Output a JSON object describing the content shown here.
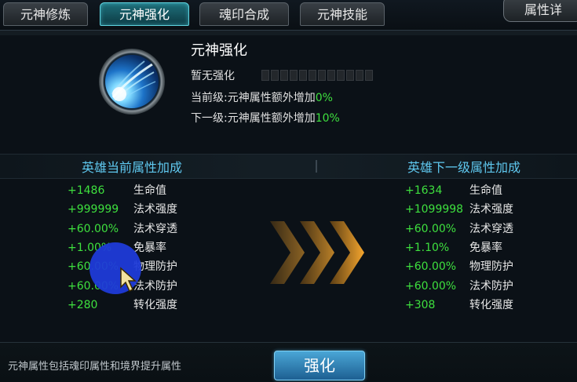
{
  "tabs": [
    {
      "label": "元神修炼",
      "active": false
    },
    {
      "label": "元神强化",
      "active": true
    },
    {
      "label": "魂印合成",
      "active": false
    },
    {
      "label": "元神技能",
      "active": false
    }
  ],
  "side_button": {
    "label": "属性详"
  },
  "header": {
    "title": "元神强化",
    "level_status": "暂无强化",
    "level_progress_segments_filled": 0,
    "current_level_label": "当前级:元神属性额外增加",
    "current_level_value": "0%",
    "next_level_label": "下一级:元神属性额外增加",
    "next_level_value": "10%",
    "icon": "spirit-comet-icon"
  },
  "current_stats": {
    "title": "英雄当前属性加成",
    "rows": [
      {
        "value": "+1486",
        "name": "生命值"
      },
      {
        "value": "+999999",
        "name": "法术强度"
      },
      {
        "value": "+60.00%",
        "name": "法术穿透"
      },
      {
        "value": "+1.00%",
        "name": "免暴率"
      },
      {
        "value": "+60.00%",
        "name": "物理防护"
      },
      {
        "value": "+60.00%",
        "name": "法术防护"
      },
      {
        "value": "+280",
        "name": "转化强度"
      }
    ]
  },
  "next_stats": {
    "title": "英雄下一级属性加成",
    "rows": [
      {
        "value": "+1634",
        "name": "生命值"
      },
      {
        "value": "+1099998",
        "name": "法术强度"
      },
      {
        "value": "+60.00%",
        "name": "法术穿透"
      },
      {
        "value": "+1.10%",
        "name": "免暴率"
      },
      {
        "value": "+60.00%",
        "name": "物理防护"
      },
      {
        "value": "+60.00%",
        "name": "法术防护"
      },
      {
        "value": "+308",
        "name": "转化强度"
      }
    ]
  },
  "footer": {
    "note": "元神属性包括魂印属性和境界提升属性",
    "button_label": "强化"
  },
  "colors": {
    "stat_value": "#3ee03e",
    "column_title": "#5fc8ef",
    "tab_active": "#1e6f7a",
    "arrow": "#f0a030"
  }
}
